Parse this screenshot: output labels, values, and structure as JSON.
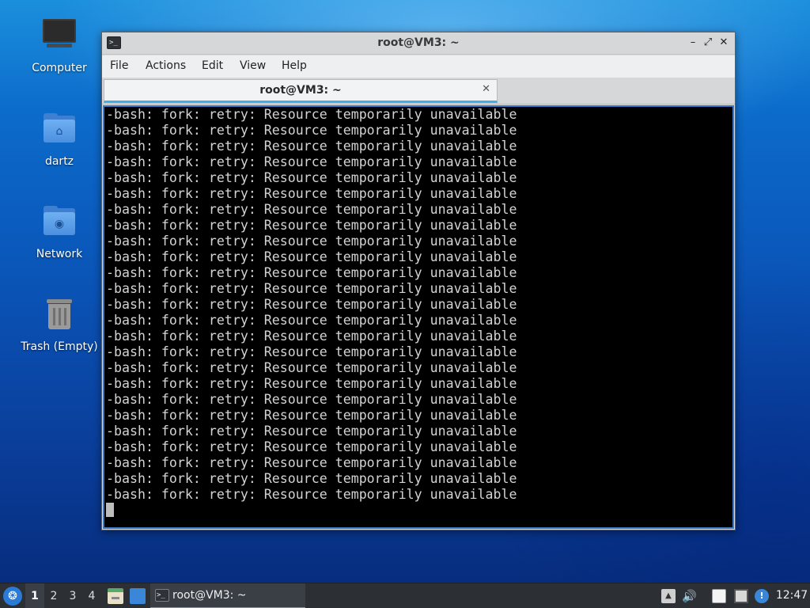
{
  "desktop": {
    "icons": [
      {
        "label": "Computer",
        "icon": "computer-icon"
      },
      {
        "label": "dartz",
        "icon": "home-folder-icon"
      },
      {
        "label": "Network",
        "icon": "network-folder-icon"
      },
      {
        "label": "Trash (Empty)",
        "icon": "trash-icon"
      }
    ]
  },
  "window": {
    "title": "root@VM3: ~",
    "menu": [
      "File",
      "Actions",
      "Edit",
      "View",
      "Help"
    ],
    "tab": {
      "title": "root@VM3: ~",
      "close": "✕"
    },
    "controls": {
      "minimize": "–",
      "maximize": "⤢",
      "close": "✕"
    },
    "terminal": {
      "lines": [
        "-bash: fork: retry: Resource temporarily unavailable",
        "-bash: fork: retry: Resource temporarily unavailable",
        "-bash: fork: retry: Resource temporarily unavailable",
        "-bash: fork: retry: Resource temporarily unavailable",
        "-bash: fork: retry: Resource temporarily unavailable",
        "-bash: fork: retry: Resource temporarily unavailable",
        "-bash: fork: retry: Resource temporarily unavailable",
        "-bash: fork: retry: Resource temporarily unavailable",
        "-bash: fork: retry: Resource temporarily unavailable",
        "-bash: fork: retry: Resource temporarily unavailable",
        "-bash: fork: retry: Resource temporarily unavailable",
        "-bash: fork: retry: Resource temporarily unavailable",
        "-bash: fork: retry: Resource temporarily unavailable",
        "-bash: fork: retry: Resource temporarily unavailable",
        "-bash: fork: retry: Resource temporarily unavailable",
        "-bash: fork: retry: Resource temporarily unavailable",
        "-bash: fork: retry: Resource temporarily unavailable",
        "-bash: fork: retry: Resource temporarily unavailable",
        "-bash: fork: retry: Resource temporarily unavailable",
        "-bash: fork: retry: Resource temporarily unavailable",
        "-bash: fork: retry: Resource temporarily unavailable",
        "-bash: fork: retry: Resource temporarily unavailable",
        "-bash: fork: retry: Resource temporarily unavailable",
        "-bash: fork: retry: Resource temporarily unavailable",
        "-bash: fork: retry: Resource temporarily unavailable"
      ]
    }
  },
  "taskbar": {
    "workspaces": [
      "1",
      "2",
      "3",
      "4"
    ],
    "active_workspace": "1",
    "task": {
      "label": "root@VM3: ~",
      "icon": "terminal-icon"
    },
    "clock": "12:47"
  },
  "colors": {
    "accent": "#3daee9",
    "terminal_bg": "#000000",
    "terminal_fg": "#d3d3d3"
  }
}
